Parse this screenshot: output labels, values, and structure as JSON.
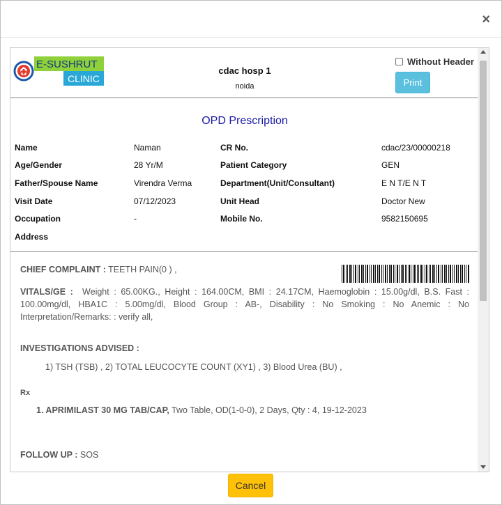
{
  "dialog": {
    "close_label": "×",
    "cancel_label": "Cancel"
  },
  "header": {
    "logo_top": "E-SUSHRUT",
    "logo_bottom": "CLINIC",
    "hospital_name": "cdac hosp 1",
    "hospital_city": "noida",
    "without_header_label": "Without Header",
    "print_label": "Print"
  },
  "title": "OPD Prescription",
  "patient": {
    "rows": [
      {
        "l1": "Name",
        "v1": "Naman",
        "l2": "CR No.",
        "v2": "cdac/23/00000218"
      },
      {
        "l1": "Age/Gender",
        "v1": "28 Yr/M",
        "l2": "Patient Category",
        "v2": "GEN"
      },
      {
        "l1": "Father/Spouse Name",
        "v1": "Virendra Verma",
        "l2": "Department(Unit/Consultant)",
        "v2": "E N T/E N T"
      },
      {
        "l1": "Visit Date",
        "v1": "07/12/2023",
        "l2": "Unit Head",
        "v2": "Doctor New"
      },
      {
        "l1": "Occupation",
        "v1": "-",
        "l2": "Mobile No.",
        "v2": "9582150695"
      },
      {
        "l1": "Address",
        "v1": "",
        "l2": "",
        "v2": ""
      }
    ]
  },
  "clinical": {
    "complaint_label": "CHIEF COMPLAINT :",
    "complaint_value": "TEETH PAIN(0 ) ,",
    "vitals_label": "VITALS/GE :",
    "vitals_value": "Weight : 65.00KG., Height : 164.00CM, BMI : 24.17CM, Haemoglobin : 15.00g/dl, B.S. Fast : 100.00mg/dl, HBA1C : 5.00mg/dl, Blood Group : AB-, Disability : No Smoking : No Anemic : No Interpretation/Remarks: : verify all,",
    "investigations_label": "INVESTIGATIONS ADVISED :",
    "investigations_value": "1) TSH (TSB) , 2) TOTAL LEUCOCYTE COUNT (XY1) , 3) Blood Urea (BU) ,",
    "rx_symbol": "Rx",
    "drug_name": "1. APRIMILAST 30 MG TAB/CAP,",
    "drug_detail": "Two Table, OD(1-0-0), 2 Days, Qty : 4, 19-12-2023",
    "followup_label": "FOLLOW UP :",
    "followup_value": "SOS"
  }
}
